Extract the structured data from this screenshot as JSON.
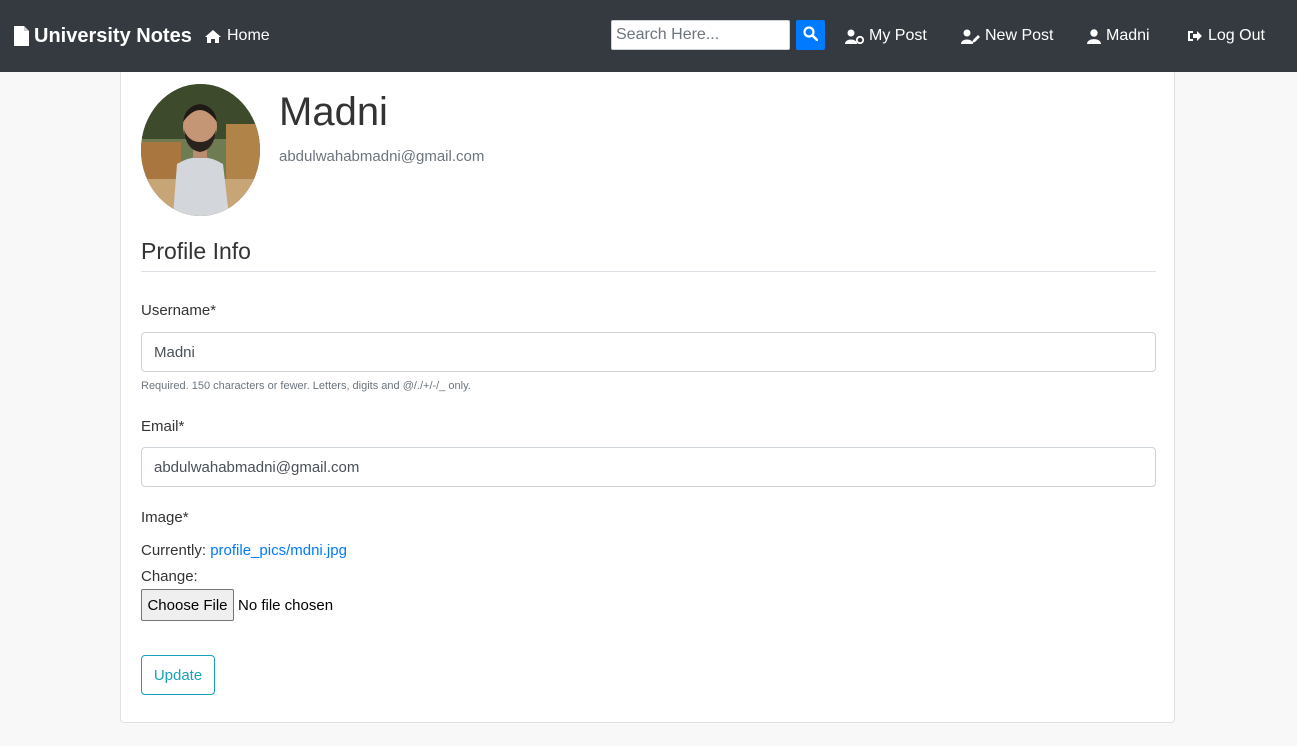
{
  "navbar": {
    "brand": "University Notes",
    "home": "Home",
    "search": {
      "placeholder": "Search Here..."
    },
    "my_post": "My Post",
    "new_post": "New Post",
    "user": "Madni",
    "logout": "Log Out"
  },
  "profile": {
    "name": "Madni",
    "email": "abdulwahabmadni@gmail.com"
  },
  "form": {
    "section_title": "Profile Info",
    "username_label": "Username*",
    "username_value": "Madni",
    "username_help": "Required. 150 characters or fewer. Letters, digits and @/./+/-/_ only.",
    "email_label": "Email*",
    "email_value": "abdulwahabmadni@gmail.com",
    "image_label": "Image*",
    "currently_label": "Currently:",
    "currently_link": "profile_pics/mdni.jpg",
    "change_label": "Change:",
    "choose_file": "Choose File",
    "no_file": "No file chosen",
    "update_button": "Update"
  },
  "colors": {
    "navbar_bg": "#343a40",
    "primary": "#007bff",
    "info": "#17a2b8"
  },
  "icons": [
    "file-icon",
    "home-icon",
    "search-icon",
    "user-cog-icon",
    "user-edit-icon",
    "user-icon",
    "sign-out-icon"
  ]
}
